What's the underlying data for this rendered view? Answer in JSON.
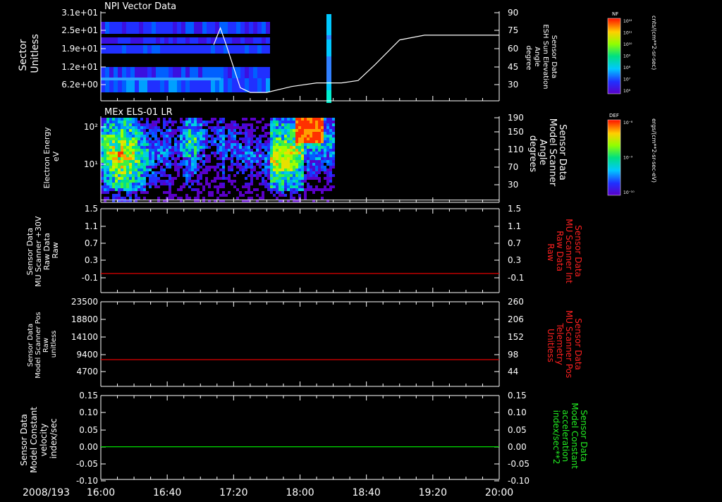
{
  "chart_data": [
    {
      "type": "heatmap",
      "title": "NPI Vector Data",
      "ylabel_left": [
        "Sector",
        "Unitless"
      ],
      "ylabel_right": [
        "Sensor Data",
        "ESH Sun Elevation",
        "Angle",
        "degree"
      ],
      "yticks_left": [
        "3.1e+01",
        "2.5e+01",
        "1.9e+01",
        "1.2e+01",
        "6.2e+00"
      ],
      "yticks_right": [
        "90",
        "75",
        "60",
        "45",
        "30"
      ],
      "ylim_right": [
        15,
        90
      ],
      "line_series": {
        "x_minutes": [
          0,
          60,
          68,
          72,
          76,
          84,
          90,
          100,
          115,
          130,
          145,
          155,
          165,
          180,
          195,
          215,
          240
        ],
        "y": [
          null,
          null,
          62,
          76,
          60,
          26,
          22,
          22,
          27,
          30,
          30,
          32,
          45,
          66,
          70,
          70,
          70
        ]
      }
    },
    {
      "type": "heatmap",
      "title": "MEx ELS-01 LR",
      "ylabel_left": [
        "Electron Energy",
        "eV"
      ],
      "ylabel_right": [
        "Sensor Data",
        "Model Scanner",
        "Angle",
        "degrees"
      ],
      "yticks_left": [
        "10²",
        "10¹"
      ],
      "yticks_right": [
        "190",
        "150",
        "110",
        "70",
        "30"
      ],
      "ylim_right": [
        0,
        190
      ],
      "line_series": {
        "x_minutes": [
          0,
          240
        ],
        "y": [
          5,
          5
        ]
      }
    },
    {
      "type": "line",
      "ylabel_left": [
        "Sensor Data",
        "MU Scanner +30V",
        "Raw Data",
        "Raw"
      ],
      "ylabel_right": [
        "Sensor Data",
        "MU Scanner Int",
        "Raw Data",
        "Raw"
      ],
      "yticks_left": [
        "1.5",
        "1.1",
        "0.7",
        "0.3",
        "-0.1"
      ],
      "yticks_right": [
        "1.5",
        "1.1",
        "0.7",
        "0.3",
        "-0.1"
      ],
      "ylim": [
        -0.3,
        1.5
      ],
      "series": [
        {
          "x_minutes": [
            0,
            240
          ],
          "y": [
            0.0,
            0.0
          ],
          "color": "#e00000"
        }
      ]
    },
    {
      "type": "line",
      "ylabel_left": [
        "Sensor Data",
        "Model Scanner Pos",
        "Raw",
        "unitless"
      ],
      "ylabel_right": [
        "Sensor Data",
        "MU Scanner Pos",
        "Telemetry",
        "Unitless"
      ],
      "yticks_left": [
        "23500",
        "18800",
        "14100",
        "9400",
        "4700"
      ],
      "yticks_right": [
        "260",
        "206",
        "152",
        "98",
        "44"
      ],
      "ylim": [
        0,
        23500
      ],
      "series": [
        {
          "x_minutes": [
            0,
            240
          ],
          "y": [
            7900,
            7900
          ],
          "color": "#e00000"
        }
      ]
    },
    {
      "type": "line",
      "ylabel_left": [
        "Sensor Data",
        "Model Constant",
        "velocity",
        "index/sec"
      ],
      "ylabel_right": [
        "Sensor Data",
        "Model Constant",
        "acceleration",
        "index/sec**2"
      ],
      "yticks_left": [
        "0.15",
        "0.10",
        "0.05",
        "0.00",
        "-0.05",
        "-0.10"
      ],
      "yticks_right": [
        "0.15",
        "0.10",
        "0.05",
        "0.00",
        "-0.05",
        "-0.10"
      ],
      "ylim": [
        -0.1,
        0.15
      ],
      "series": [
        {
          "x_minutes": [
            0,
            240
          ],
          "y": [
            0.0,
            0.0
          ],
          "color": "#00dd00"
        }
      ]
    }
  ],
  "x_axis": {
    "date_label": "2008/193",
    "tick_labels": [
      "16:00",
      "16:40",
      "17:20",
      "18:00",
      "18:40",
      "19:20",
      "20:00"
    ],
    "range_minutes": [
      0,
      240
    ]
  },
  "colorbars": [
    {
      "title": "NF",
      "unit": "cnts/(cm**2-sr-sec)",
      "ticks": [
        "10¹²",
        "10¹¹",
        "10¹⁰",
        "10⁹",
        "10⁸",
        "10⁷",
        "10⁶"
      ]
    },
    {
      "title": "DEF",
      "unit": "ergs/(cm**2-sr-sec-eV)",
      "ticks": [
        "10⁻⁸",
        "10⁻⁹",
        "10⁻¹⁰"
      ]
    }
  ],
  "colors": {
    "text": "#ffffff",
    "red_label": "#ff2020",
    "green_label": "#22ee22",
    "axis": "#ffffff"
  }
}
